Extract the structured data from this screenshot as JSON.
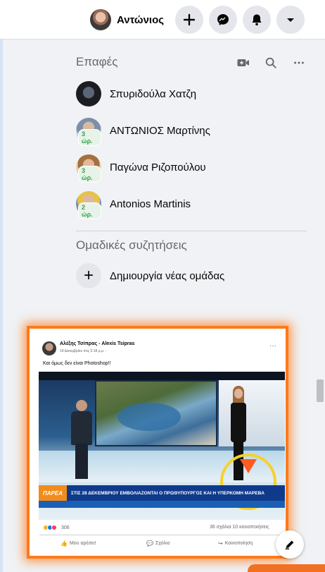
{
  "header": {
    "profile_name": "Αντώνιος",
    "buttons": [
      "create-icon",
      "messenger-icon",
      "notifications-icon",
      "account-menu-icon"
    ]
  },
  "contacts": {
    "title": "Επαφές",
    "header_icons": [
      "new-room-icon",
      "search-icon",
      "more-icon"
    ],
    "items": [
      {
        "name": "Σπυριδούλα Χατζη",
        "badge": ""
      },
      {
        "name": "ΑΝΤΩΝΙΟΣ Μαρτίνης",
        "badge": "3 ώρ."
      },
      {
        "name": "Παγώνα Ριζοπούλου",
        "badge": "3 ώρ."
      },
      {
        "name": "Antonios Martinis",
        "badge": "2 ώρ."
      }
    ]
  },
  "group_chats": {
    "title": "Ομαδικές συζητήσεις",
    "create_label": "Δημιουργία νέας ομάδας"
  },
  "embedded_post": {
    "author": "Αλέξης Τσίπρας - Alexis Tsipras",
    "time": "19 Δεκεμβρίου στις 5:18 μ.μ. · ",
    "text": "Και όμως δεν είναι Photoshop!!",
    "video": {
      "channel_logo": "ΠΑΡΕΑ",
      "headline": "ΣΤΙΣ 28 ΔΕΚΕΜΒΡΙΟΥ ΕΜΒΟΛΙΑΖΟΝΤΑΙ Ο ΠΡΩΘΥΠΟΥΡΓΟΣ ΚΑΙ Η ΥΠΕΡΚΟΜΗ ΜΑΡΕΒΑ"
    },
    "reaction_count": "306",
    "stats": "36 σχόλια  10 κοινοποιήσεις",
    "actions": [
      "Μου αρέσει!",
      "Σχόλιο",
      "Κοινοποίηση"
    ],
    "highlight_color": "#ff7a1a"
  }
}
